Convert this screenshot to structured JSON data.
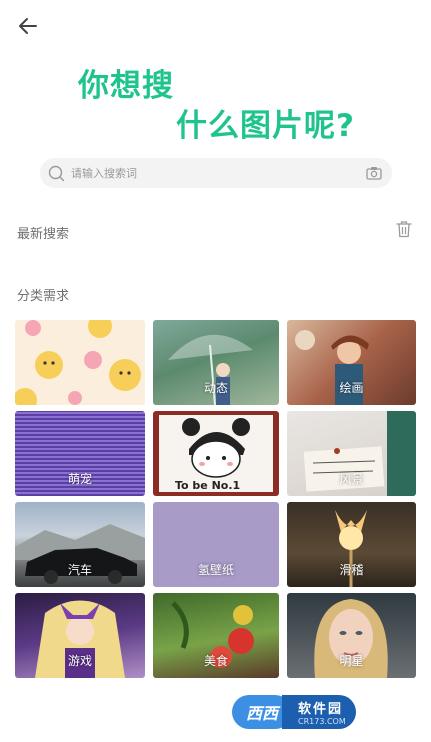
{
  "header": {
    "back_icon": "arrow-left-icon",
    "hero_line1": "你想搜",
    "hero_line2": "什么图片呢?",
    "accent_color": "#1fc48d"
  },
  "search": {
    "placeholder": "请输入搜索词",
    "search_icon": "search-icon",
    "camera_icon": "camera-icon"
  },
  "recent": {
    "title": "最新搜索",
    "clear_icon": "trash-icon"
  },
  "categories": {
    "title": "分类需求",
    "items": [
      {
        "label": ""
      },
      {
        "label": "动态"
      },
      {
        "label": "绘画"
      },
      {
        "label": "萌宠"
      },
      {
        "label": ""
      },
      {
        "label": "风景"
      },
      {
        "label": "汽车"
      },
      {
        "label": "氢壁纸"
      },
      {
        "label": "滑稽"
      },
      {
        "label": "游戏"
      },
      {
        "label": "美食"
      },
      {
        "label": "明星"
      }
    ]
  },
  "watermark": {
    "badge": "西西",
    "name": "软件园",
    "url": "CR173.COM"
  }
}
